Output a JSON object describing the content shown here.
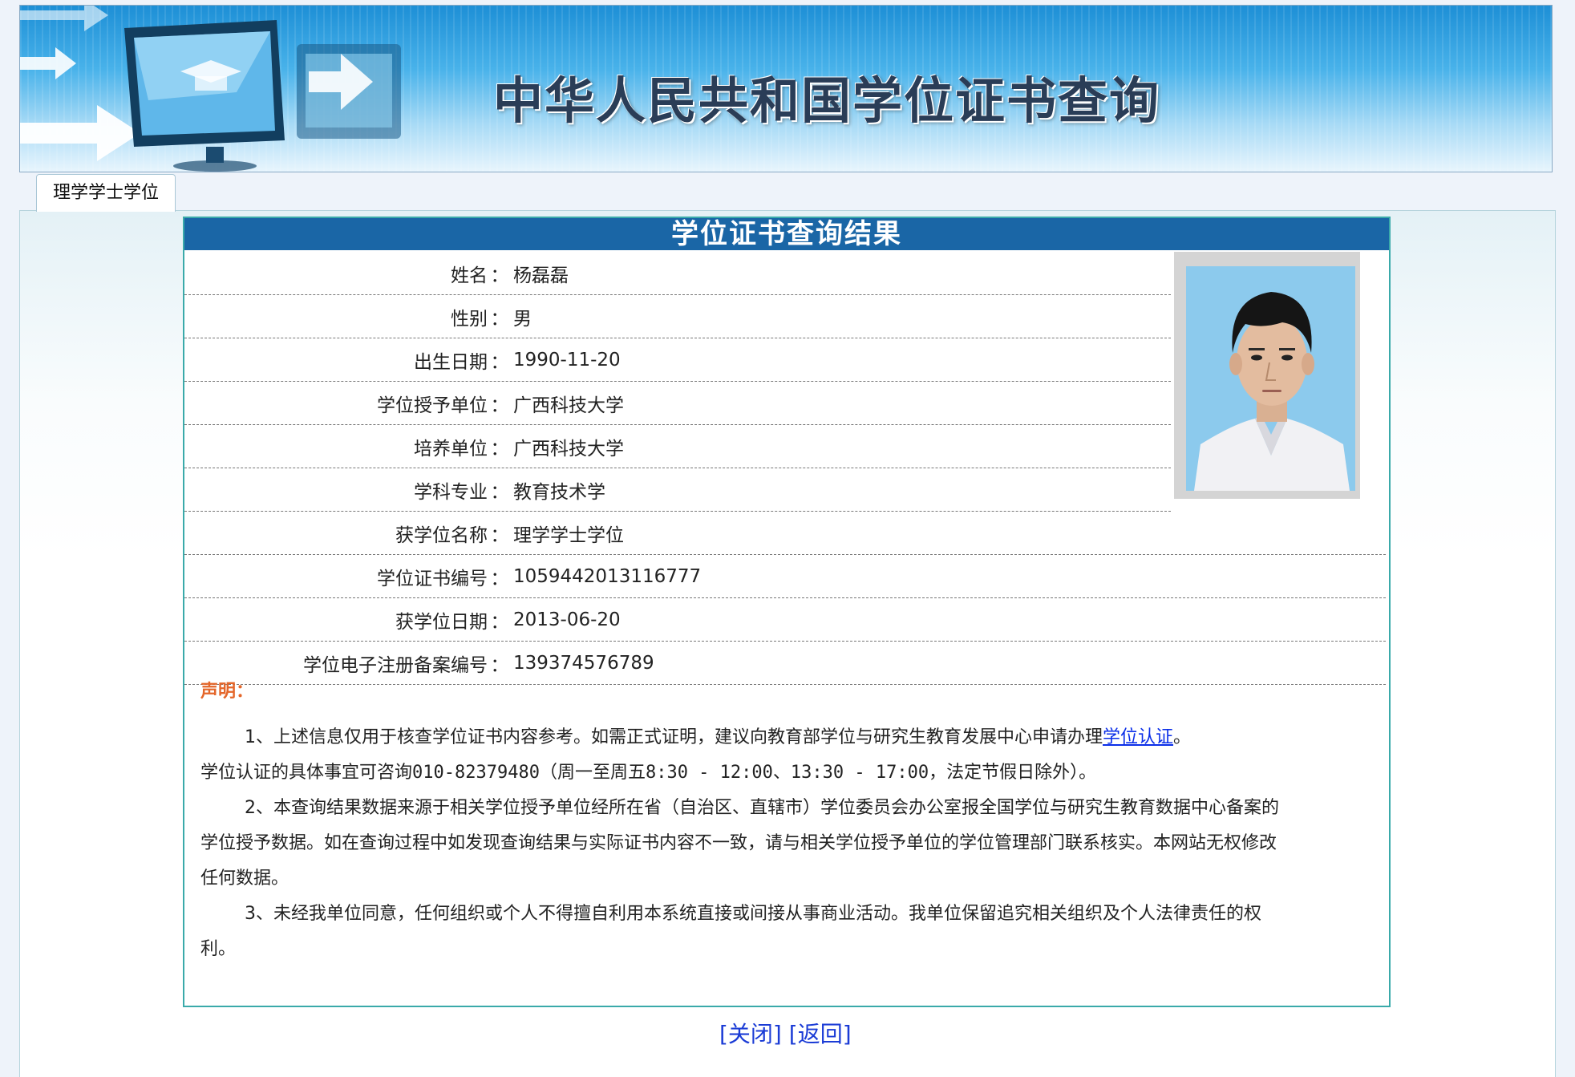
{
  "banner": {
    "title": "中华人民共和国学位证书查询"
  },
  "tab": {
    "label": "理学学士学位"
  },
  "result": {
    "title": "学位证书查询结果",
    "separator": "：",
    "rows": [
      {
        "label": "姓名",
        "value": "杨磊磊"
      },
      {
        "label": "性别",
        "value": "男"
      },
      {
        "label": "出生日期",
        "value": "1990-11-20"
      },
      {
        "label": "学位授予单位",
        "value": "广西科技大学"
      },
      {
        "label": "培养单位",
        "value": "广西科技大学"
      },
      {
        "label": "学科专业",
        "value": "教育技术学"
      },
      {
        "label": "获学位名称",
        "value": "理学学士学位"
      },
      {
        "label": "学位证书编号",
        "value": "1059442013116777"
      },
      {
        "label": "获学位日期",
        "value": "2013-06-20"
      },
      {
        "label": "学位电子注册备案编号",
        "value": "139374576789"
      }
    ]
  },
  "statement": {
    "title": "声明：",
    "p1_before_link": "1、上述信息仅用于核查学位证书内容参考。如需正式证明，建议向教育部学位与研究生教育发展中心申请办理",
    "p1_link": "学位认证",
    "p1_after_link": "。",
    "p1_line2_prefix": "学位认证的具体事宜可咨询",
    "p1_line2_phone": "010-82379480（周一至周五8:30 - 12:00、13:30 - 17:00，法定节假日除外）。",
    "p2": "2、本查询结果数据来源于相关学位授予单位经所在省（自治区、直辖市）学位委员会办公室报全国学位与研究生教育数据中心备案的学位授予数据。如在查询过程中如发现查询结果与实际证书内容不一致，请与相关学位授予单位的学位管理部门联系核实。本网站无权修改任何数据。",
    "p3": "3、未经我单位同意，任何组织或个人不得擅自利用本系统直接或间接从事商业活动。我单位保留追究相关组织及个人法律责任的权利。"
  },
  "footer": {
    "close_label": "[关闭]",
    "back_label": "[返回]"
  },
  "colors": {
    "title_bar": "#1a66a6",
    "box_border": "#3aaaaa",
    "statement_title": "#e4662a",
    "link": "#1b3cd6"
  }
}
